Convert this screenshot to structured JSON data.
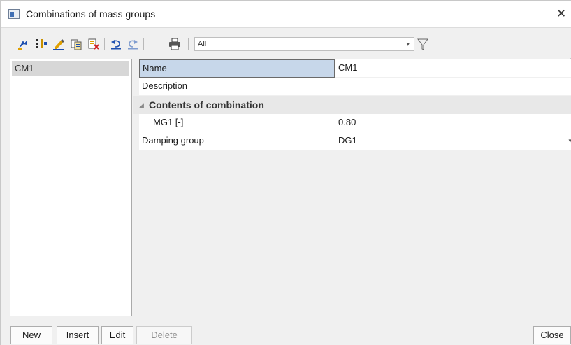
{
  "window": {
    "title": "Combinations of mass groups",
    "close_glyph": "✕"
  },
  "toolbar": {
    "icons": [
      "select-icon",
      "columns-icon",
      "edit-pencil-icon",
      "copy-icon",
      "delete-doc-icon",
      "undo-icon",
      "redo-icon",
      "print-icon",
      "filter-icon"
    ],
    "filter_value": "All",
    "filter_arrow": "▾"
  },
  "list": {
    "items": [
      "CM1"
    ]
  },
  "properties": {
    "name_label": "Name",
    "name_value": "CM1",
    "description_label": "Description",
    "description_value": "",
    "category_label": "Contents of combination",
    "category_toggle": "◢",
    "mg1_label": "MG1 [-]",
    "mg1_value": "0.80",
    "damping_label": "Damping group",
    "damping_value": "DG1",
    "damping_arrow": "▾"
  },
  "footer": {
    "new_label": "New",
    "insert_label": "Insert",
    "edit_label": "Edit",
    "delete_label": "Delete",
    "close_label": "Close"
  },
  "colors": {
    "selected_cell": "#c7d7ea",
    "list_selected": "#d7d7d7",
    "window_bg": "#f0f0f0"
  }
}
